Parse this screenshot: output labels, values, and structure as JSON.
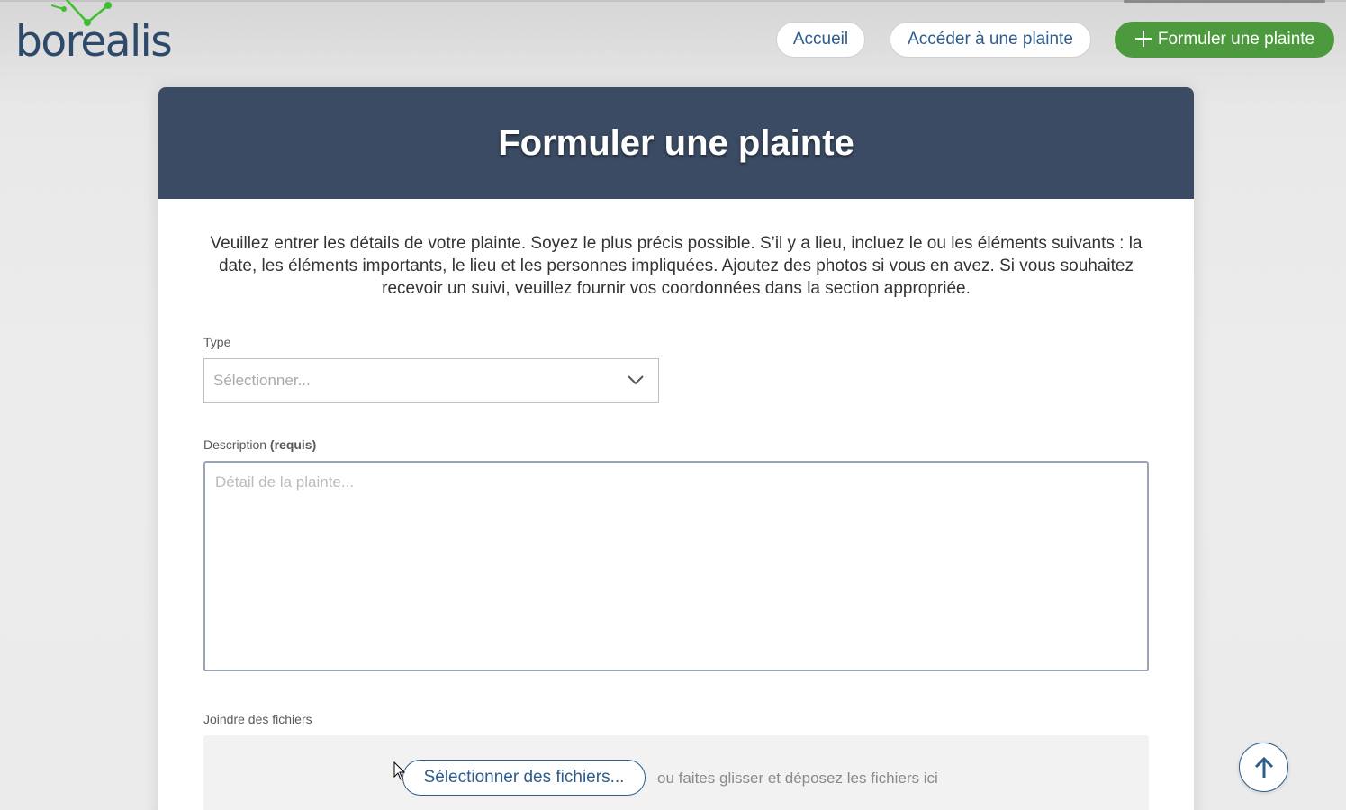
{
  "brand": {
    "logo_text": "borealis",
    "logo_icon": "constellation-icon"
  },
  "nav": {
    "home_label": "Accueil",
    "access_label": "Accéder à une plainte",
    "file_label": "Formuler une plainte",
    "file_icon": "plus-icon"
  },
  "page": {
    "title": "Formuler une plainte",
    "intro": "Veuillez entrer les détails de votre plainte. Soyez le plus précis possible. S’il y a lieu, incluez le ou les éléments suivants : la date, les éléments importants, le lieu et les personnes impliquées. Ajoutez des photos si vous en avez. Si vous souhaitez recevoir un suivi, veuillez fournir vos coordonnées dans la section appropriée."
  },
  "form": {
    "type_label": "Type",
    "type_placeholder": "Sélectionner...",
    "description_label": "Description",
    "description_required": "(requis)",
    "description_placeholder": "Détail de la plainte...",
    "files_label": "Joindre des fichiers",
    "files_button": "Sélectionner des fichiers...",
    "files_hint": "ou faites glisser et déposez les fichiers ici"
  },
  "colors": {
    "brand_navy": "#2d4a6b",
    "header_bar": "#3b4b63",
    "accent_green": "#4d9a3e",
    "link_blue": "#2e5d8c",
    "logo_green": "#3fbf2f"
  },
  "scroll_top_icon": "arrow-up-icon"
}
